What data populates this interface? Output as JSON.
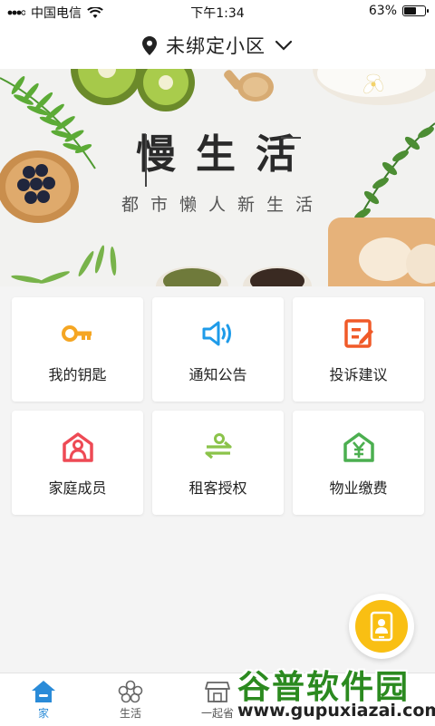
{
  "status_bar": {
    "carrier": "中国电信",
    "time": "下午1:34",
    "battery": "63%",
    "battery_level": 0.63
  },
  "header": {
    "title": "未绑定小区"
  },
  "banner": {
    "title": "慢生活",
    "subtitle": "都市懒人新生活"
  },
  "grid": [
    {
      "label": "我的钥匙",
      "icon": "key-icon",
      "color": "#f5a623"
    },
    {
      "label": "通知公告",
      "icon": "speaker-icon",
      "color": "#1e9be9"
    },
    {
      "label": "投诉建议",
      "icon": "edit-icon",
      "color": "#f05a28"
    },
    {
      "label": "家庭成员",
      "icon": "family-icon",
      "color": "#ee4a55"
    },
    {
      "label": "租客授权",
      "icon": "transfer-icon",
      "color": "#8bc34a"
    },
    {
      "label": "物业缴费",
      "icon": "yuan-house-icon",
      "color": "#4caf50"
    }
  ],
  "tabs": [
    {
      "label": "家",
      "icon": "home-icon",
      "active": true
    },
    {
      "label": "生活",
      "icon": "flower-icon",
      "active": false
    },
    {
      "label": "一起省",
      "icon": "shop-icon",
      "active": false
    }
  ],
  "watermark": {
    "text": "谷普软件园",
    "url": "www.gupuxiazai.com"
  },
  "colors": {
    "accent": "#2a8bd8",
    "fab": "#f9bf13"
  }
}
